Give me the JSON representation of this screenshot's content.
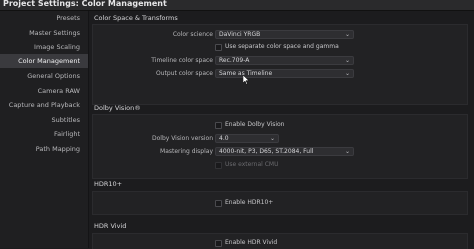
{
  "window": {
    "title": "Project Settings:  Color Management"
  },
  "sidebar": {
    "items": [
      {
        "label": "Presets"
      },
      {
        "label": "Master Settings"
      },
      {
        "label": "Image Scaling"
      },
      {
        "label": "Color Management"
      },
      {
        "label": "General Options"
      },
      {
        "label": "Camera RAW"
      },
      {
        "label": "Capture and Playback"
      },
      {
        "label": "Subtitles"
      },
      {
        "label": "Fairlight"
      },
      {
        "label": "Path Mapping"
      }
    ],
    "active_index": 3
  },
  "color_space": {
    "title": "Color Space & Transforms",
    "color_science_label": "Color science",
    "color_science_value": "DaVinci YRGB",
    "separate_checkbox_label": "Use separate color space and gamma",
    "timeline_label": "Timeline color space",
    "timeline_value": "Rec.709-A",
    "output_label": "Output color space",
    "output_value": "Same as Timeline"
  },
  "dolby": {
    "title": "Dolby Vision®",
    "enable_label": "Enable Dolby Vision",
    "version_label": "Dolby Vision version",
    "version_value": "4.0",
    "mastering_label": "Mastering display",
    "mastering_value": "4000-nit, P3, D65, ST.2084, Full",
    "external_label": "Use external CMU"
  },
  "hdr10": {
    "title": "HDR10+",
    "enable_label": "Enable HDR10+"
  },
  "hdrvivid": {
    "title": "HDR Vivid",
    "enable_label": "Enable HDR Vivid"
  }
}
